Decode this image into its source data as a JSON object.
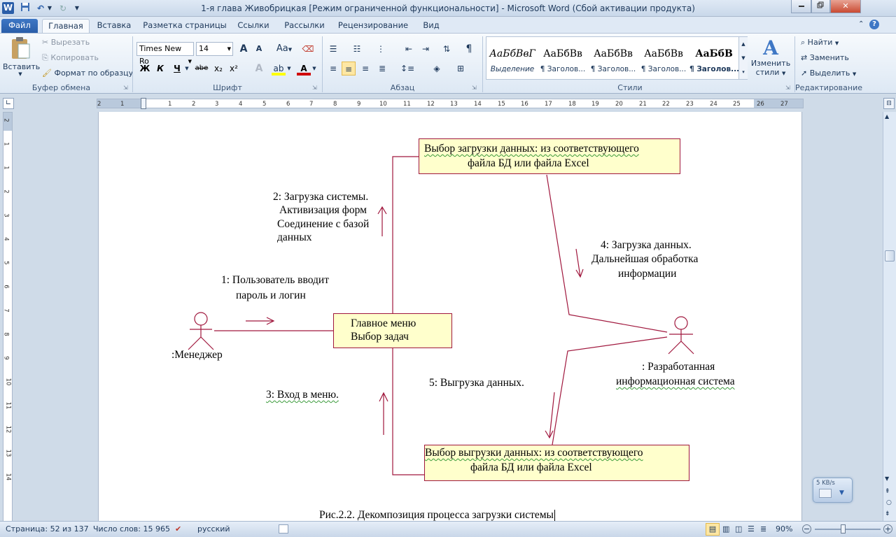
{
  "window": {
    "title": "1-я глава Живобрицкая [Режим ограниченной функциональности]  -  Microsoft Word (Сбой активации продукта)",
    "app_icon_letter": "W"
  },
  "tabs": [
    {
      "label": "Файл"
    },
    {
      "label": "Главная"
    },
    {
      "label": "Вставка"
    },
    {
      "label": "Разметка страницы"
    },
    {
      "label": "Ссылки"
    },
    {
      "label": "Рассылки"
    },
    {
      "label": "Рецензирование"
    },
    {
      "label": "Вид"
    }
  ],
  "clipboard": {
    "paste_label": "Вставить",
    "cut_label": "Вырезать",
    "copy_label": "Копировать",
    "format_painter_label": "Формат по образцу",
    "group_label": "Буфер обмена"
  },
  "font": {
    "font_name": "Times New Ro",
    "font_size": "14",
    "group_label": "Шрифт",
    "bold_glyph": "Ж",
    "italic_glyph": "К",
    "underline_glyph": "Ч",
    "strike_glyph": "abe",
    "case_glyph": "Aa",
    "grow_glyph": "A",
    "shrink_glyph": "A"
  },
  "paragraph": {
    "group_label": "Абзац",
    "pilcrow": "¶"
  },
  "styles": {
    "group_label": "Стили",
    "items": [
      {
        "sample": "АаБбВвГ",
        "name": "Выделение"
      },
      {
        "sample": "АаБбВв",
        "name": "¶ Заголов..."
      },
      {
        "sample": "АаБбВв",
        "name": "¶ Заголов..."
      },
      {
        "sample": "АаБбВв",
        "name": "¶ Заголов..."
      },
      {
        "sample": "АаБбВ",
        "name": "¶ Заголов..."
      }
    ],
    "change_styles_label_1": "Изменить",
    "change_styles_label_2": "стили"
  },
  "editing": {
    "group_label": "Редактирование",
    "find_label": "Найти",
    "replace_label": "Заменить",
    "select_label": "Выделить"
  },
  "ruler": {
    "ticks": [
      "2",
      "1",
      "1",
      "2",
      "3",
      "4",
      "5",
      "6",
      "7",
      "8",
      "9",
      "10",
      "11",
      "12",
      "13",
      "14",
      "15",
      "16",
      "17",
      "18",
      "19",
      "20",
      "21",
      "22",
      "23",
      "24",
      "25",
      "26",
      "27"
    ],
    "vticks": [
      "2",
      "1",
      "1",
      "2",
      "3",
      "4",
      "5",
      "6",
      "7",
      "8",
      "9",
      "10",
      "11",
      "12",
      "13",
      "14"
    ]
  },
  "diagram": {
    "box_load_choice_l1": "Выбор  загрузки данных: из соответствующего",
    "box_load_choice_l2": "файла БД или файла Excel",
    "msg2_l1": "2: Загрузка системы.",
    "msg2_l2": "Активизация форм",
    "msg2_l3": "Соединение с базой",
    "msg2_l4": "данных",
    "msg4_l1": "4: Загрузка данных.",
    "msg4_l2": "Дальнейшая   обработка",
    "msg4_l3": "информации",
    "msg1_l1": "1: Пользователь вводит",
    "msg1_l2": "пароль и логин",
    "main_menu_l1": "Главное меню",
    "main_menu_l2": "Выбор задач",
    "actor_manager": ":Менеджер",
    "actor_system_l1": ": Разработанная",
    "actor_system_l2": "информационная  система",
    "msg5": "5: Выгрузка данных.",
    "msg3": "3: Вход  в меню.",
    "box_unload_choice_l1": "Выбор выгрузки данных: из соответствующего",
    "box_unload_choice_l2": "файла БД или файла Excel",
    "caption": "Рис.2.2. Декомпозиция процесса загрузки системы"
  },
  "status": {
    "page": "Страница: 52 из 137",
    "words": "Число слов: 15 965",
    "language": "русский",
    "zoom": "90%"
  },
  "net_widget": {
    "speed": "5 KB/s"
  },
  "colors": {
    "diagram_line": "#a0173d",
    "box_fill": "#ffffcc",
    "file_tab": "#2a5ea9",
    "spell_wave": "#3a9a3a"
  }
}
